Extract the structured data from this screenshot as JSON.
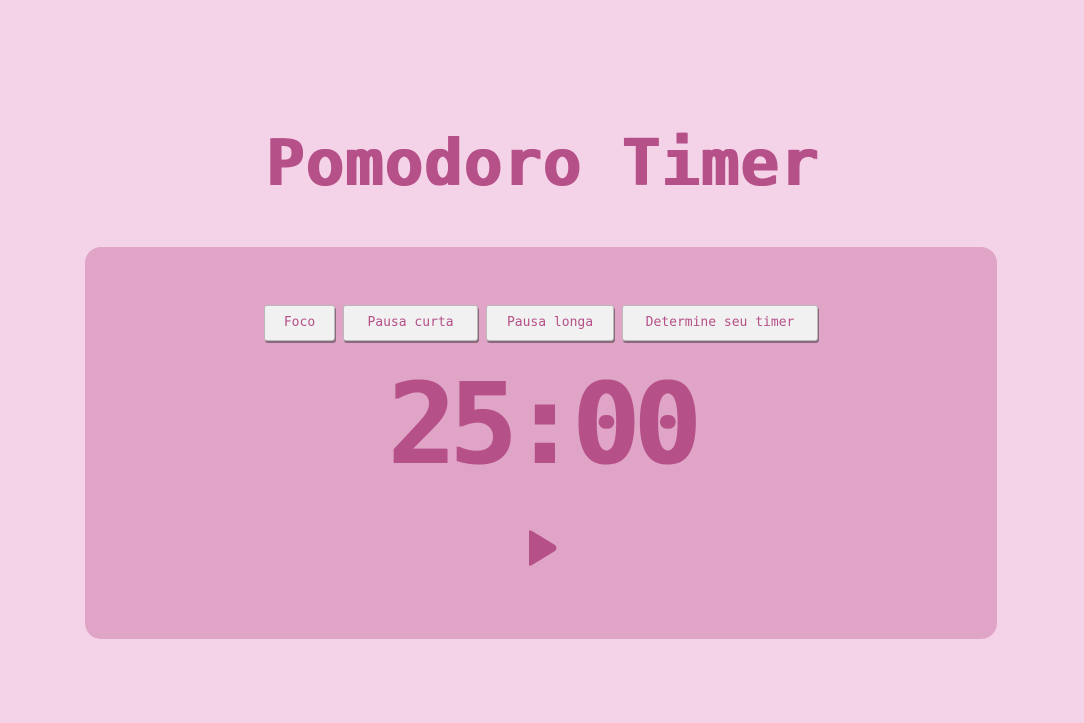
{
  "header": {
    "title": "Pomodoro Timer"
  },
  "tabs": [
    {
      "label": "Foco"
    },
    {
      "label": "Pausa curta"
    },
    {
      "label": "Pausa longa"
    },
    {
      "label": "Determine seu timer"
    }
  ],
  "timer": {
    "display": "25:00"
  },
  "controls": {
    "play_icon": "play-icon"
  },
  "colors": {
    "background": "#f4d2e7",
    "panel": "#e0a4c6",
    "accent": "#b65088",
    "button_bg": "#f1f1f1"
  }
}
